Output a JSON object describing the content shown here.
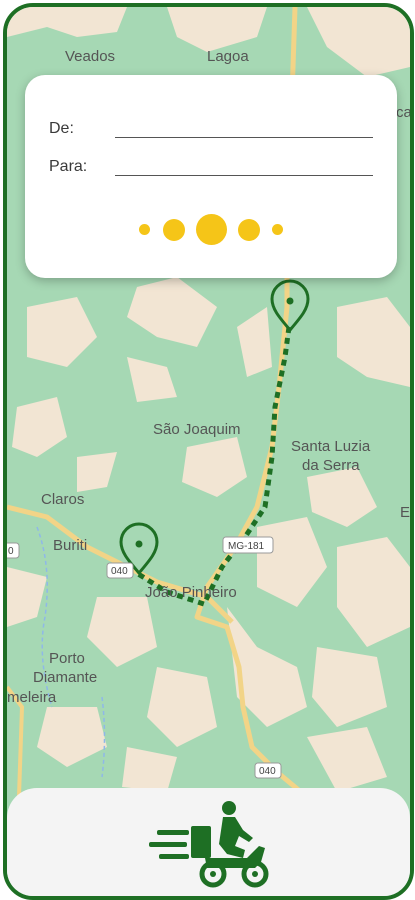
{
  "map": {
    "places": {
      "veados": "Veados",
      "lagoa": "Lagoa",
      "sao_joaquim": "São Joaquim",
      "santa_luzia_1": "Santa Luzia",
      "santa_luzia_2": "da Serra",
      "claros": "Claros",
      "buriti": "Buriti",
      "joao_pinheiro": "João Pinheiro",
      "porto_1": "Porto",
      "porto_2": "Diamante",
      "meleira": "meleira",
      "edge_e": "E",
      "edge_ca": "ca"
    },
    "shields": {
      "mg181": "MG-181",
      "r040_a": "040",
      "r040_b": "040",
      "left_d": "0"
    }
  },
  "route_card": {
    "from_label": "De:",
    "from_value": "",
    "to_label": "Para:",
    "to_value": ""
  },
  "bottom_bar": {
    "icon": "delivery-scooter-icon"
  },
  "colors": {
    "brand_green": "#1e6f24",
    "accent_yellow": "#f5c518",
    "map_green": "#a6d8b4",
    "map_beige": "#f2e5d3",
    "road_yellow": "#f2d487"
  }
}
